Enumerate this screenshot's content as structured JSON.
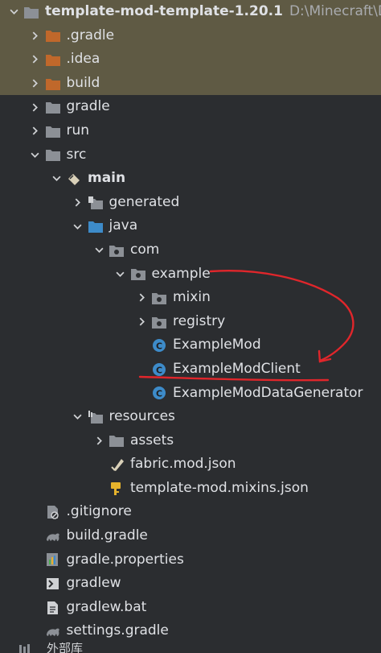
{
  "project": {
    "name": "template-mod-template-1.20.1",
    "path": "D:\\Minecraft\\D"
  },
  "tree": [
    {
      "label": ".gradle",
      "depth": 1,
      "chevron": "right",
      "icon": "folder-orange-icon",
      "excluded": true
    },
    {
      "label": ".idea",
      "depth": 1,
      "chevron": "right",
      "icon": "folder-orange-icon",
      "excluded": true
    },
    {
      "label": "build",
      "depth": 1,
      "chevron": "right",
      "icon": "folder-orange-icon",
      "excluded": true
    },
    {
      "label": "gradle",
      "depth": 1,
      "chevron": "right",
      "icon": "folder-grey-icon"
    },
    {
      "label": "run",
      "depth": 1,
      "chevron": "right",
      "icon": "folder-grey-icon"
    },
    {
      "label": "src",
      "depth": 1,
      "chevron": "down",
      "icon": "folder-grey-icon"
    },
    {
      "label": "main",
      "depth": 2,
      "chevron": "down",
      "icon": "source-set-icon",
      "bold": true
    },
    {
      "label": "generated",
      "depth": 3,
      "chevron": "right",
      "icon": "generated-folder-icon"
    },
    {
      "label": "java",
      "depth": 3,
      "chevron": "down",
      "icon": "folder-blue-icon"
    },
    {
      "label": "com",
      "depth": 4,
      "chevron": "down",
      "icon": "package-icon"
    },
    {
      "label": "example",
      "depth": 5,
      "chevron": "down",
      "icon": "package-icon"
    },
    {
      "label": "mixin",
      "depth": 6,
      "chevron": "right",
      "icon": "package-icon"
    },
    {
      "label": "registry",
      "depth": 6,
      "chevron": "right",
      "icon": "package-icon"
    },
    {
      "label": "ExampleMod",
      "depth": 6,
      "chevron": "none",
      "icon": "class-icon"
    },
    {
      "label": "ExampleModClient",
      "depth": 6,
      "chevron": "none",
      "icon": "class-icon"
    },
    {
      "label": "ExampleModDataGenerator",
      "depth": 6,
      "chevron": "none",
      "icon": "class-icon"
    },
    {
      "label": "resources",
      "depth": 3,
      "chevron": "down",
      "icon": "resources-folder-icon"
    },
    {
      "label": "assets",
      "depth": 4,
      "chevron": "right",
      "icon": "folder-grey-icon"
    },
    {
      "label": "fabric.mod.json",
      "depth": 4,
      "chevron": "none",
      "icon": "json-file-icon"
    },
    {
      "label": "template-mod.mixins.json",
      "depth": 4,
      "chevron": "none",
      "icon": "json-key-file-icon"
    },
    {
      "label": ".gitignore",
      "depth": 1,
      "chevron": "none",
      "icon": "gitignore-file-icon"
    },
    {
      "label": "build.gradle",
      "depth": 1,
      "chevron": "none",
      "icon": "gradle-file-icon"
    },
    {
      "label": "gradle.properties",
      "depth": 1,
      "chevron": "none",
      "icon": "properties-file-icon"
    },
    {
      "label": "gradlew",
      "depth": 1,
      "chevron": "none",
      "icon": "shell-file-icon"
    },
    {
      "label": "gradlew.bat",
      "depth": 1,
      "chevron": "none",
      "icon": "text-file-icon"
    },
    {
      "label": "settings.gradle",
      "depth": 1,
      "chevron": "none",
      "icon": "gradle-file-icon"
    }
  ],
  "external_libraries": {
    "label": "外部库"
  },
  "colors": {
    "background": "#2b2d30",
    "excluded_row": "#5f5a44",
    "folder_orange": "#c0682b",
    "folder_grey": "#8c9096",
    "folder_blue": "#3d8bc9",
    "class_icon": "#3d8bc9",
    "annotation": "#e0262b"
  }
}
